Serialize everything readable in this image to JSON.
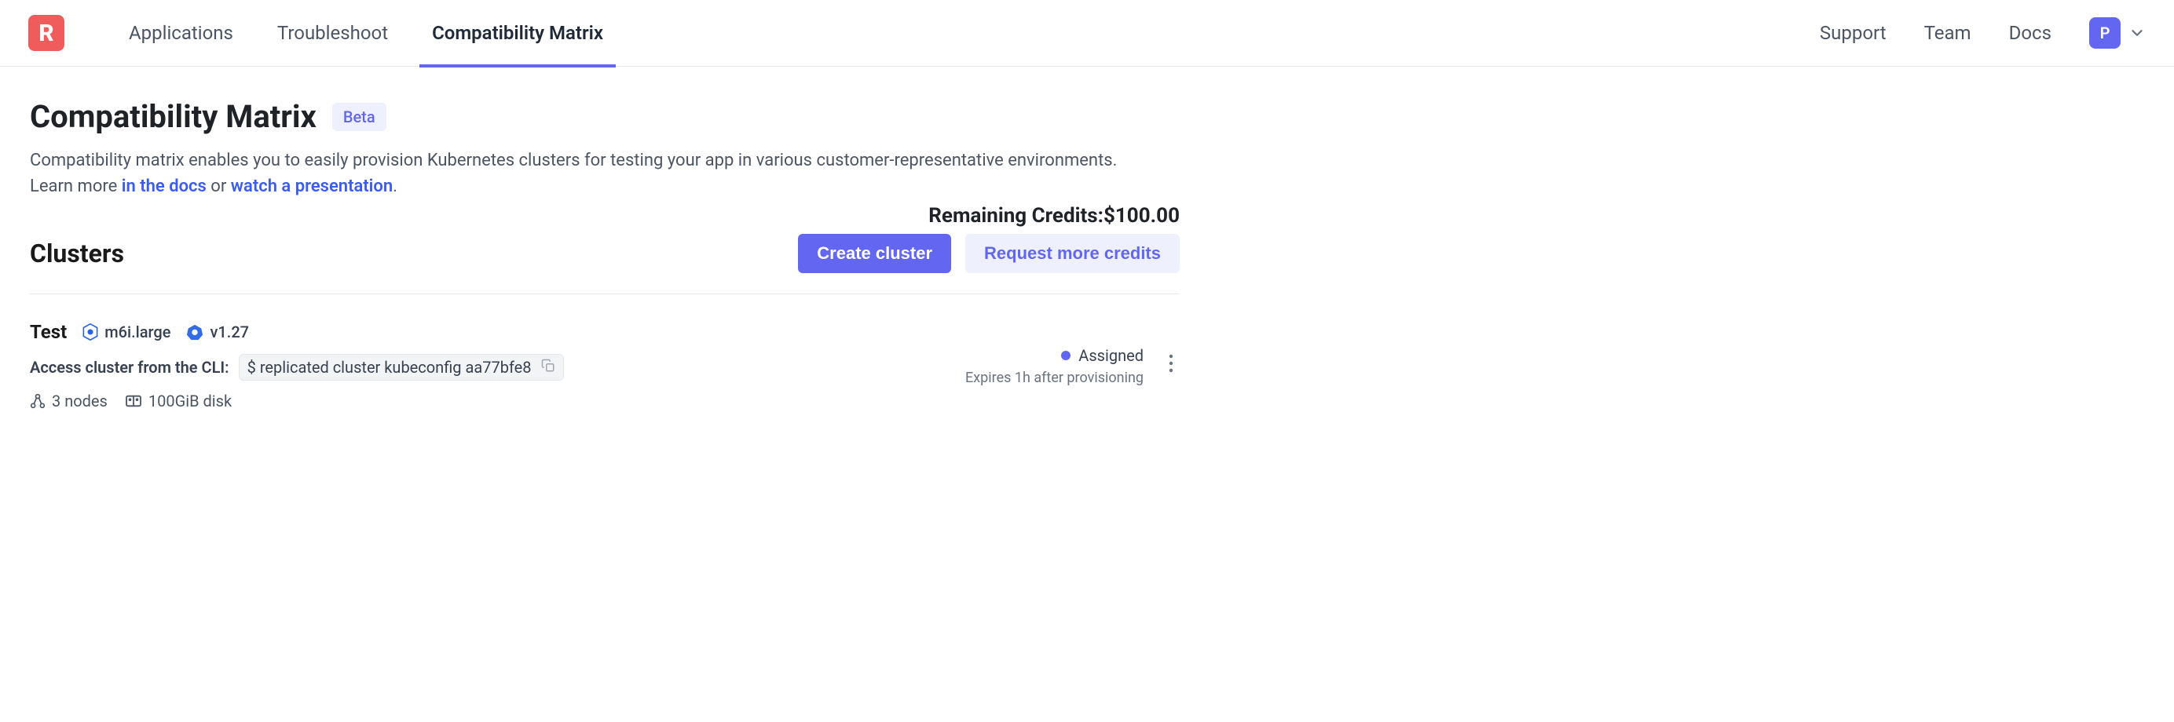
{
  "nav": {
    "items": [
      "Applications",
      "Troubleshoot",
      "Compatibility Matrix"
    ],
    "active_index": 2,
    "right": [
      "Support",
      "Team",
      "Docs"
    ],
    "avatar_letter": "P"
  },
  "page": {
    "title": "Compatibility Matrix",
    "badge": "Beta",
    "desc_prefix": "Compatibility matrix enables you to easily provision Kubernetes clusters for testing your app in various customer-representative environments.",
    "learn_more_label": "Learn more ",
    "docs_link": "in the docs",
    "or_label": " or ",
    "watch_link": "watch a presentation",
    "period": ".",
    "credits_label": "Remaining Credits: ",
    "credits_value": "$100.00"
  },
  "clusters_section": {
    "title": "Clusters",
    "create_label": "Create cluster",
    "request_label": "Request more credits"
  },
  "cluster": {
    "name": "Test",
    "instance_type": "m6i.large",
    "k8s_version": "v1.27",
    "cli_label": "Access cluster from the CLI:",
    "cli_cmd": "$ replicated cluster kubeconfig aa77bfe8",
    "nodes": "3 nodes",
    "disk": "100GiB disk",
    "status": "Assigned",
    "expires": "Expires 1h after provisioning"
  }
}
